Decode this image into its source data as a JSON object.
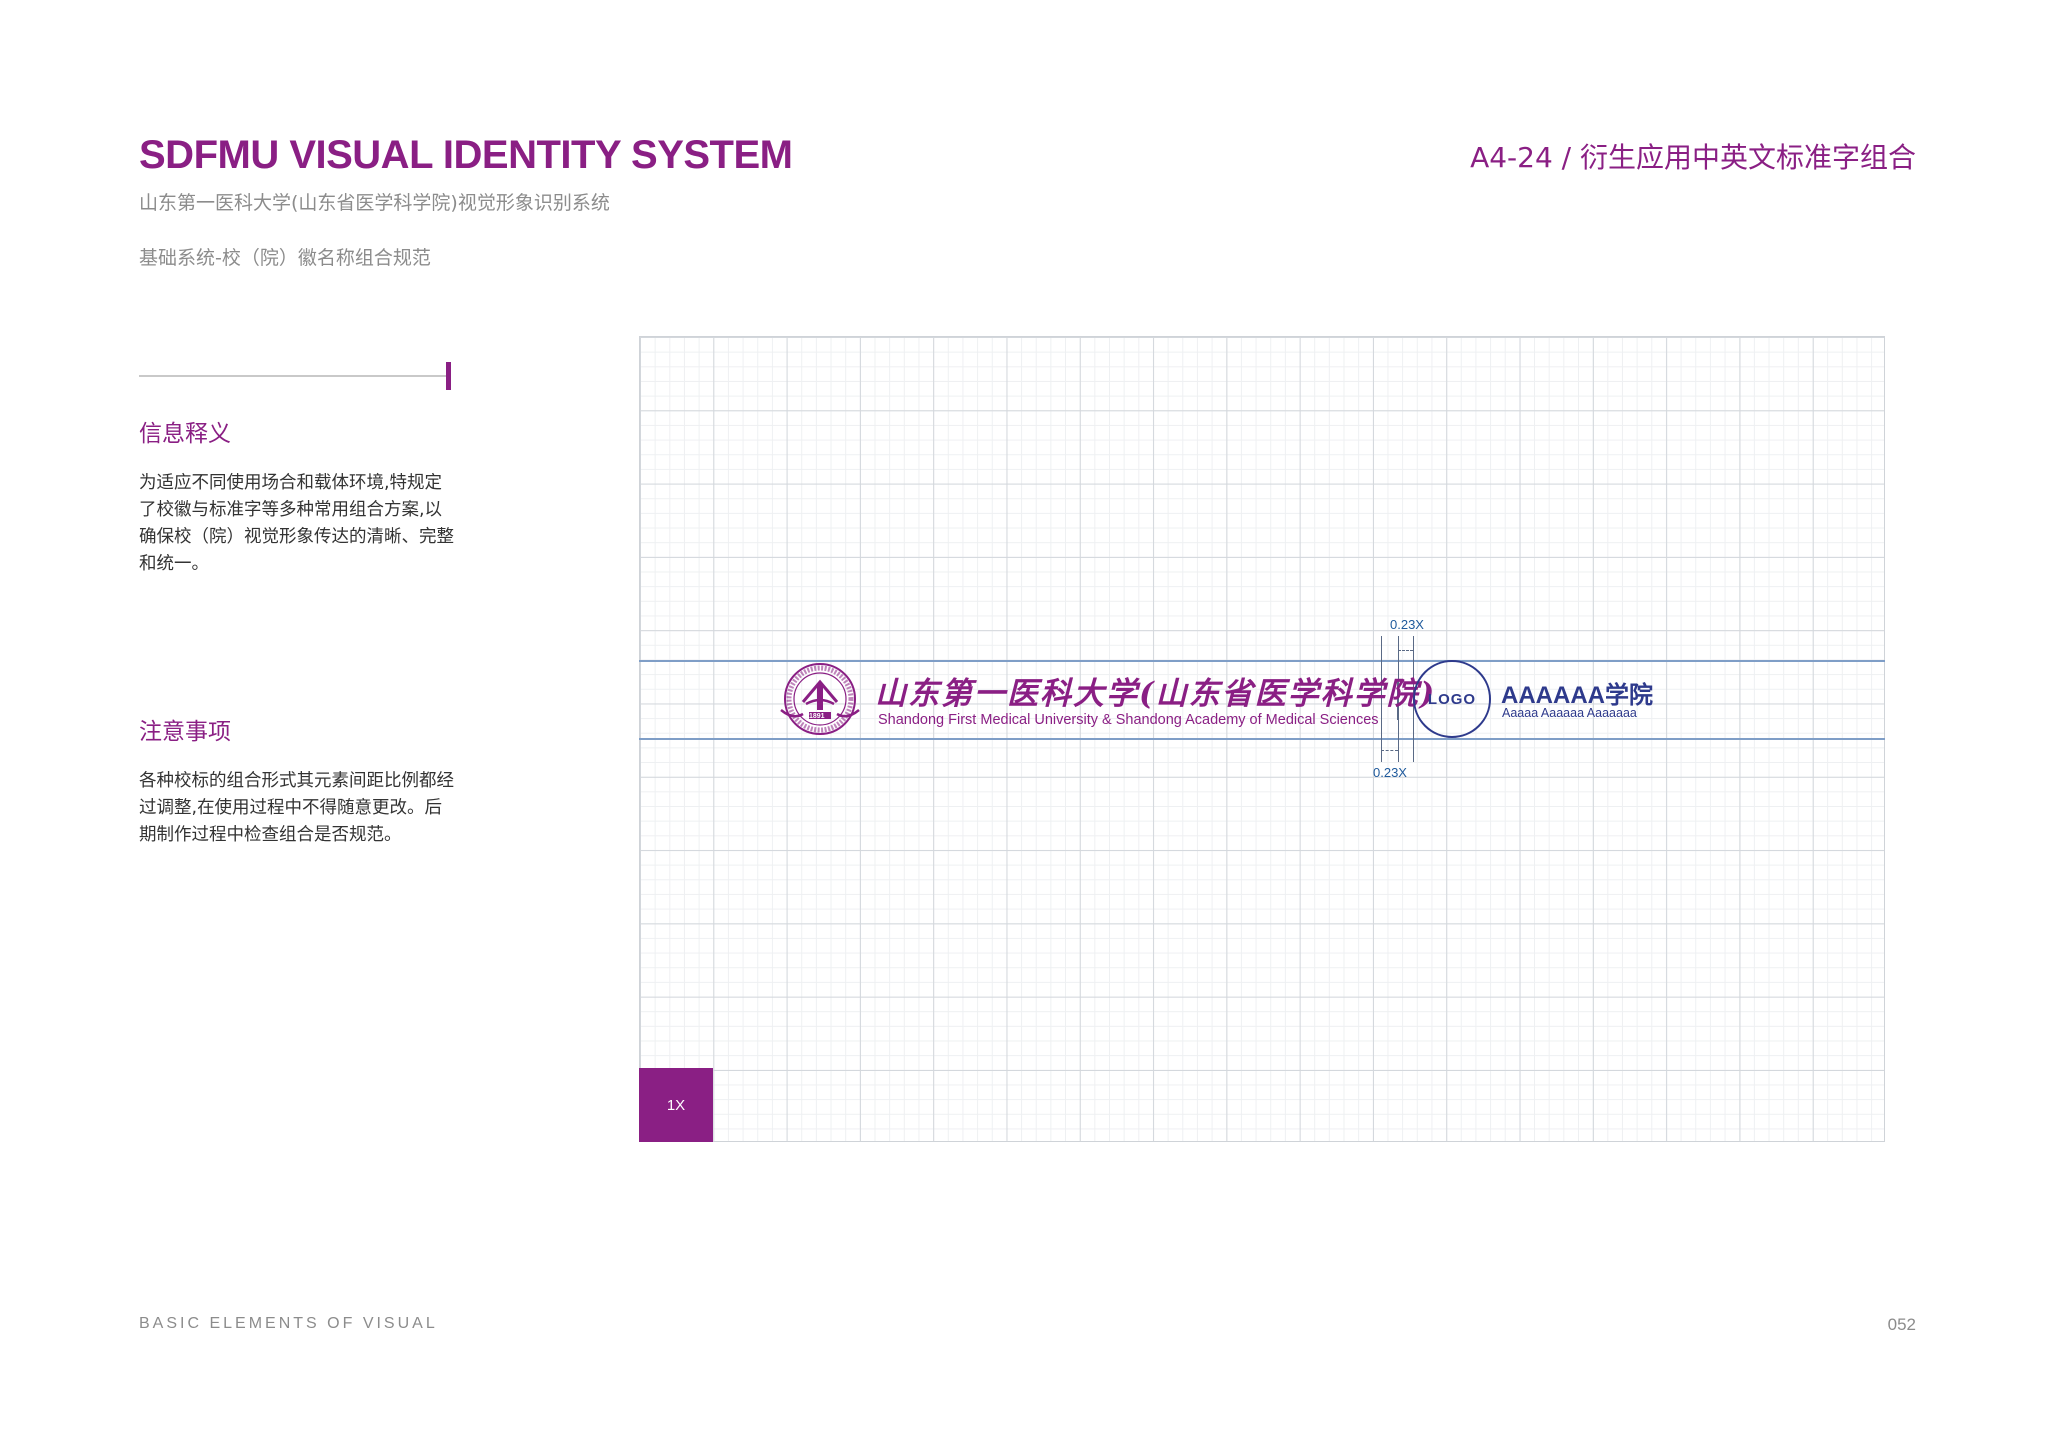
{
  "header": {
    "title_en": "SDFMU VISUAL IDENTITY SYSTEM",
    "title_cn": "山东第一医科大学(山东省医学科学院)视觉形象识别系统",
    "section": "基础系统-校（院）徽名称组合规范",
    "page_code": "A4-24 /  衍生应用中英文标准字组合"
  },
  "info": {
    "heading": "信息释义",
    "body": "为适应不同使用场合和载体环境,特规定了校徽与标准字等多种常用组合方案,以确保校（院）视觉形象传达的清晰、完整和统一。"
  },
  "note": {
    "heading": "注意事项",
    "body": "各种校标的组合形式其元素间距比例都经过调整,在使用过程中不得随意更改。后期制作过程中检查组合是否规范。"
  },
  "diagram": {
    "unit_label": "1X",
    "spacing_top": "0.23X",
    "spacing_bottom": "0.23X",
    "univ_name_cn": "山东第一医科大学(山东省医学科学院)",
    "univ_name_en": "Shandong First Medical University & Shandong Academy of Medical Sciences",
    "logo_placeholder": "LOGO",
    "college_cn": "AAAAAA学院",
    "college_en": "Aaaaa Aaaaaa Aaaaaaa",
    "seal_year": "1891"
  },
  "footer": {
    "left": "BASIC ELEMENTS OF VISUAL",
    "page_number": "052"
  },
  "colors": {
    "brand_purple": "#8a1f84",
    "college_blue": "#2e3a8c",
    "guide_blue": "#7f9ec7"
  }
}
